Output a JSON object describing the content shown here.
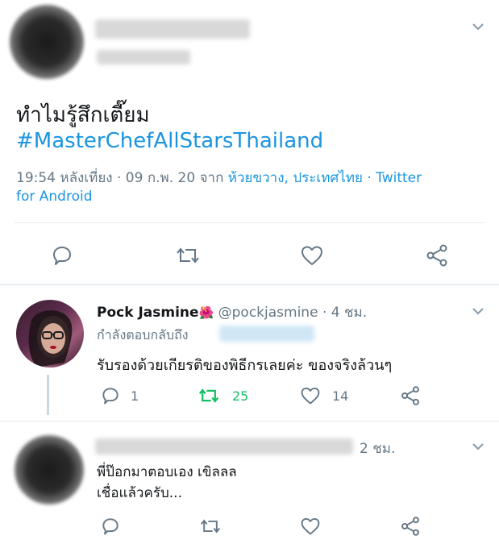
{
  "main_tweet": {
    "text": "ทำไมรู้สึกเตี๊ยม",
    "hashtag": "#MasterChefAllStarsThailand",
    "time": "19:54 หลังเที่ยง · 09 ก.พ. 20 จาก ",
    "location": "ห้วยขวาง, ประเทศไทย",
    "source_sep": " · Twitter",
    "source_cont": "for Android"
  },
  "reply1": {
    "name": "Pock Jasmine",
    "emoji": "🌺",
    "handle": "@pockjasmine",
    "age": "· 4 ชม.",
    "replying_to": "กำลังตอบกลับถึง",
    "text": "รับรองด้วยเกียรติของพิธีกรเลยค่ะ ของจริงล้วนๆ",
    "reply_count": "1",
    "retweet_count": "25",
    "like_count": "14"
  },
  "reply2": {
    "age": "2 ชม.",
    "text_line1": "พี่ป๊อกมาตอบเอง เขิลลล",
    "text_line2": "เชื่อแล้วครับ..."
  },
  "colors": {
    "accent": "#1b95e0",
    "retweet_active": "#17bf63",
    "muted": "#657786"
  }
}
